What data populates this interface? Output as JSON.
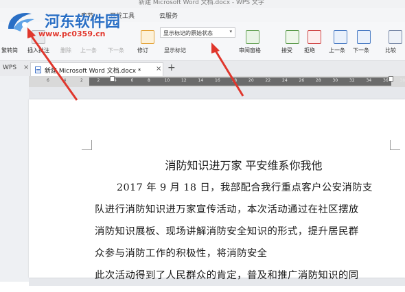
{
  "window": {
    "title": "新建 Microsoft Word 文档.docx - WPS 文字"
  },
  "menubar": {
    "items": [
      "章节",
      "开发工具",
      "云服务"
    ]
  },
  "ribbon": {
    "groups": [
      {
        "label": "插入批注",
        "dim": false
      },
      {
        "label": "删除",
        "dim": true
      },
      {
        "label": "上一条",
        "dim": true
      },
      {
        "label": "下一条",
        "dim": true
      },
      {
        "label": "修订",
        "dim": false
      },
      {
        "label": "显示标记",
        "dim": false
      },
      {
        "label": "审阅窗格",
        "dim": false
      },
      {
        "label": "接受",
        "dim": false
      },
      {
        "label": "拒绝",
        "dim": false
      },
      {
        "label": "上一条",
        "dim": false
      },
      {
        "label": "下一条",
        "dim": false
      },
      {
        "label": "比较",
        "dim": false
      }
    ],
    "left_partial_label": "繁转简",
    "display_mode_select": "显示标记的原始状态"
  },
  "tabs": {
    "home": "WPS",
    "document": "新建 Microsoft Word 文档.docx *",
    "add": "+"
  },
  "ruler": {
    "ticks": [
      "6",
      "4",
      "2",
      "2",
      "4",
      "6",
      "8",
      "10",
      "12",
      "14",
      "16",
      "18",
      "20",
      "22",
      "24",
      "26",
      "28",
      "30",
      "32",
      "34",
      "36",
      "38"
    ]
  },
  "document": {
    "title": "消防知识进万家 平安维系你我他",
    "lines": [
      "2017 年 9 月 18 日，我部配合我行重点客户公安消防支",
      "队进行消防知识进万家宣传活动，本次活动通过在社区摆放",
      "消防知识展板、现场讲解消防安全知识的形式，提升居民群",
      "众参与消防工作的积极性，将消防安全",
      "此次活动得到了人民群众的肯定，普及和推广消防知识的同"
    ]
  },
  "watermark": {
    "name": "河东软件园",
    "url": "www.pc0359.cn"
  },
  "colors": {
    "accent": "#2a6fc5",
    "arrow": "#e0362c",
    "ruler_dark": "#6b6b6b"
  }
}
